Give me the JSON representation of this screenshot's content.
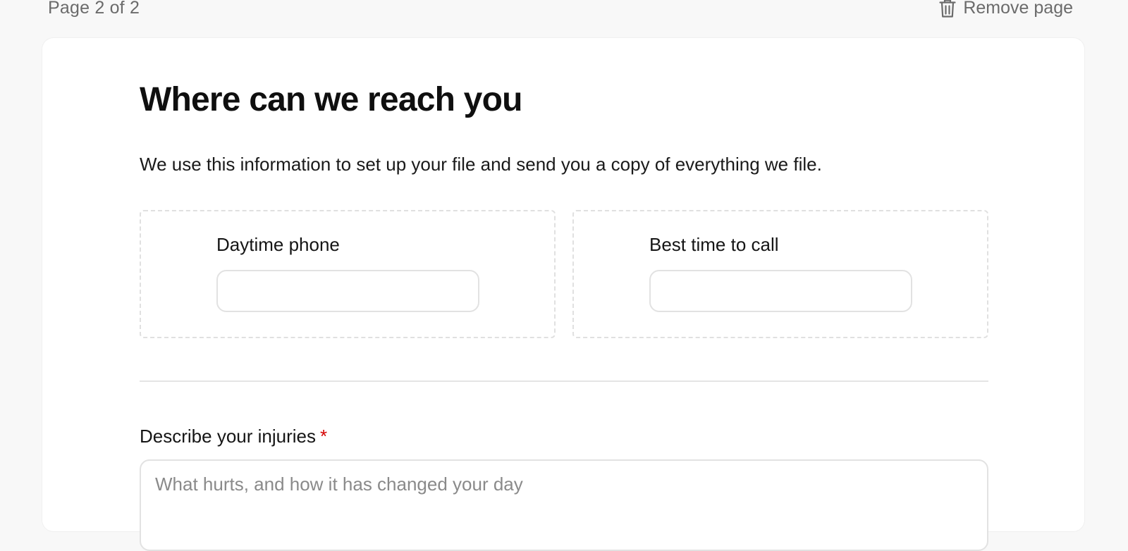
{
  "header": {
    "page_indicator": "Page 2 of 2",
    "remove_page_label": "Remove page",
    "remove_page_icon": "trash-icon"
  },
  "form": {
    "title": "Where can we reach you",
    "subtitle": "We use this information to set up your file and send you a copy of everything we file.",
    "fields": [
      {
        "label": "Daytime phone",
        "value": ""
      },
      {
        "label": "Best time to call",
        "value": ""
      }
    ],
    "injuries": {
      "label": "Describe your injuries",
      "required_marker": "*",
      "placeholder": "What hurts, and how it has changed your day",
      "value": ""
    }
  },
  "colors": {
    "background": "#f8f8f8",
    "card": "#ffffff",
    "muted_text": "#6b6b6b",
    "required": "#d40000",
    "border": "#e2e2e2"
  }
}
